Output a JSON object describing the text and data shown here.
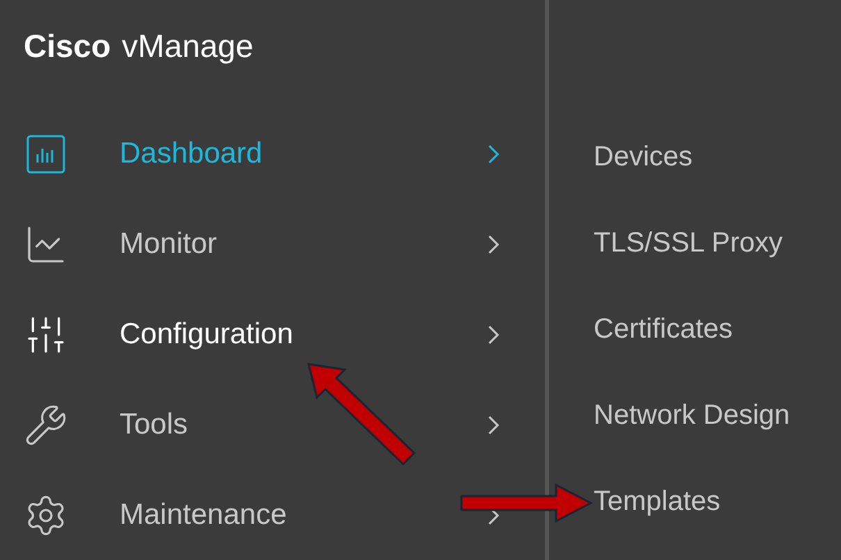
{
  "header": {
    "brand": "Cisco",
    "product": "vManage"
  },
  "menu": [
    {
      "label": "Dashboard",
      "selected": true,
      "hovered": false
    },
    {
      "label": "Monitor",
      "selected": false,
      "hovered": false
    },
    {
      "label": "Configuration",
      "selected": false,
      "hovered": true
    },
    {
      "label": "Tools",
      "selected": false,
      "hovered": false
    },
    {
      "label": "Maintenance",
      "selected": false,
      "hovered": false
    }
  ],
  "submenu": [
    {
      "label": "Devices"
    },
    {
      "label": "TLS/SSL Proxy"
    },
    {
      "label": "Certificates"
    },
    {
      "label": "Network Design"
    },
    {
      "label": "Templates"
    }
  ]
}
